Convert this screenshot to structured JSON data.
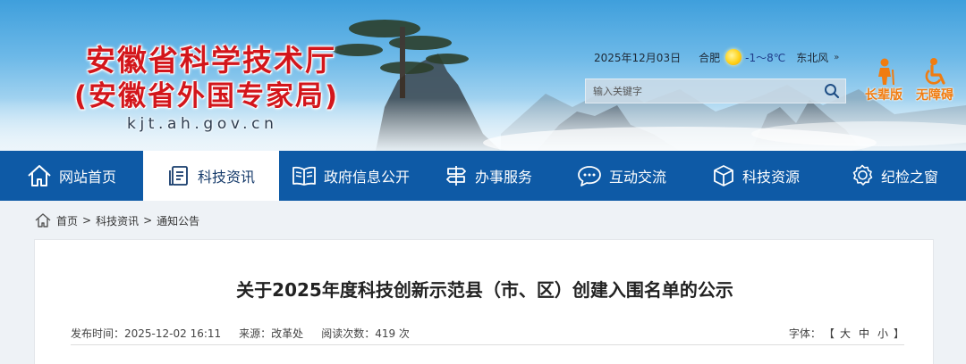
{
  "header": {
    "title_line1": "安徽省科学技术厅",
    "title_line2": "(安徽省外国专家局)",
    "domain": "kjt.ah.gov.cn",
    "date": "2025年12月03日",
    "city": "合肥",
    "weather_icon": "sun-icon",
    "temperature": "-1～8℃",
    "wind": "东北风",
    "more_glyph": "»",
    "search_placeholder": "输入关键字",
    "elder_label": "长辈版",
    "accessibility_label": "无障碍"
  },
  "nav": {
    "items": [
      {
        "label": "网站首页",
        "icon": "home-icon"
      },
      {
        "label": "科技资讯",
        "icon": "news-document-icon"
      },
      {
        "label": "政府信息公开",
        "icon": "open-book-icon"
      },
      {
        "label": "办事服务",
        "icon": "service-signpost-icon"
      },
      {
        "label": "互动交流",
        "icon": "chat-bubble-icon"
      },
      {
        "label": "科技资源",
        "icon": "resource-cube-icon"
      },
      {
        "label": "纪检之窗",
        "icon": "gear-badge-icon"
      }
    ],
    "active_index": 1
  },
  "breadcrumb": {
    "home": "首页",
    "sep": ">",
    "level1": "科技资讯",
    "level2": "通知公告"
  },
  "article": {
    "title": "关于2025年度科技创新示范县（市、区）创建入围名单的公示",
    "publish_label": "发布时间：",
    "publish_time": "2025-12-02 16:11",
    "source_label": "来源：",
    "source": "改革处",
    "views_label": "阅读次数：",
    "views": "419 次",
    "fontsize_label": "字体：",
    "bracket_open": "【",
    "size_large": "大",
    "size_medium": "中",
    "size_small": "小",
    "bracket_close": "】"
  },
  "colors": {
    "nav_bg": "#0e5aa6",
    "title_red": "#d3161b",
    "tool_orange": "#f07c10"
  }
}
